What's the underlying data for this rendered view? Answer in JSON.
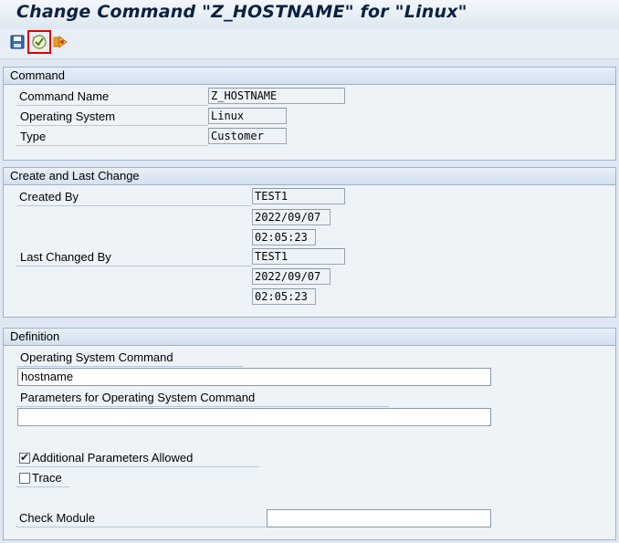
{
  "title": "Change Command \"Z_HOSTNAME\" for \"Linux\"",
  "toolbar": {
    "save_icon": "save-icon",
    "check_icon": "check-icon",
    "execute_icon": "execute-icon"
  },
  "command_group": {
    "header": "Command",
    "command_name_label": "Command Name",
    "command_name_value": "Z_HOSTNAME",
    "os_label": "Operating System",
    "os_value": "Linux",
    "type_label": "Type",
    "type_value": "Customer"
  },
  "change_group": {
    "header": "Create and Last Change",
    "created_by_label": "Created By",
    "created_by_value": "TEST1",
    "created_date": "2022/09/07",
    "created_time": "02:05:23",
    "last_changed_label": "Last Changed By",
    "last_changed_value": "TEST1",
    "changed_date": "2022/09/07",
    "changed_time": "02:05:23"
  },
  "definition_group": {
    "header": "Definition",
    "os_command_label": "Operating System Command",
    "os_command_value": "hostname",
    "params_label": "Parameters for Operating System Command",
    "params_value": "",
    "additional_params_label": "Additional Parameters Allowed",
    "additional_params_checked": true,
    "trace_label": "Trace",
    "trace_checked": false,
    "check_module_label": "Check Module",
    "check_module_value": ""
  },
  "colors": {
    "background": "#dfe8f2",
    "group_border": "#9db2c9",
    "selection_outline": "#e00000"
  }
}
